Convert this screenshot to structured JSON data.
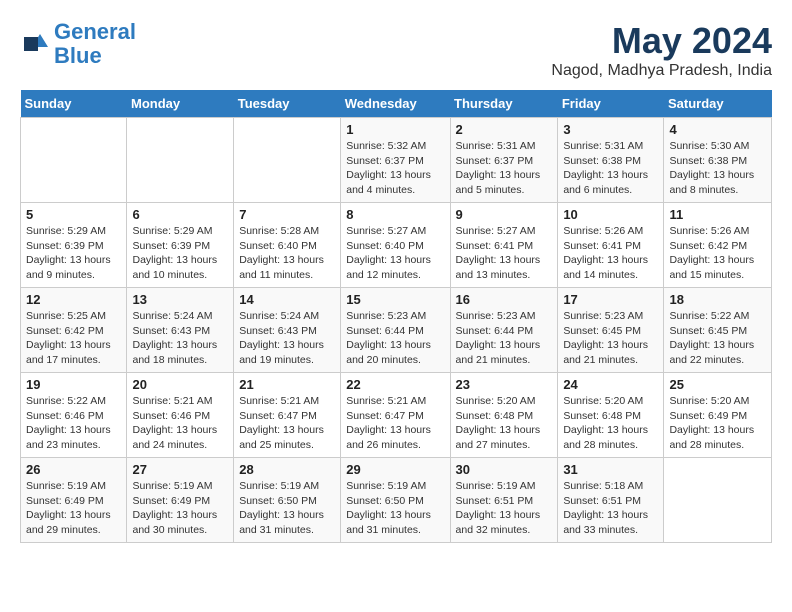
{
  "logo": {
    "line1": "General",
    "line2": "Blue"
  },
  "title": {
    "month_year": "May 2024",
    "location": "Nagod, Madhya Pradesh, India"
  },
  "headers": [
    "Sunday",
    "Monday",
    "Tuesday",
    "Wednesday",
    "Thursday",
    "Friday",
    "Saturday"
  ],
  "weeks": [
    [
      {
        "day": "",
        "info": ""
      },
      {
        "day": "",
        "info": ""
      },
      {
        "day": "",
        "info": ""
      },
      {
        "day": "1",
        "info": "Sunrise: 5:32 AM\nSunset: 6:37 PM\nDaylight: 13 hours\nand 4 minutes."
      },
      {
        "day": "2",
        "info": "Sunrise: 5:31 AM\nSunset: 6:37 PM\nDaylight: 13 hours\nand 5 minutes."
      },
      {
        "day": "3",
        "info": "Sunrise: 5:31 AM\nSunset: 6:38 PM\nDaylight: 13 hours\nand 6 minutes."
      },
      {
        "day": "4",
        "info": "Sunrise: 5:30 AM\nSunset: 6:38 PM\nDaylight: 13 hours\nand 8 minutes."
      }
    ],
    [
      {
        "day": "5",
        "info": "Sunrise: 5:29 AM\nSunset: 6:39 PM\nDaylight: 13 hours\nand 9 minutes."
      },
      {
        "day": "6",
        "info": "Sunrise: 5:29 AM\nSunset: 6:39 PM\nDaylight: 13 hours\nand 10 minutes."
      },
      {
        "day": "7",
        "info": "Sunrise: 5:28 AM\nSunset: 6:40 PM\nDaylight: 13 hours\nand 11 minutes."
      },
      {
        "day": "8",
        "info": "Sunrise: 5:27 AM\nSunset: 6:40 PM\nDaylight: 13 hours\nand 12 minutes."
      },
      {
        "day": "9",
        "info": "Sunrise: 5:27 AM\nSunset: 6:41 PM\nDaylight: 13 hours\nand 13 minutes."
      },
      {
        "day": "10",
        "info": "Sunrise: 5:26 AM\nSunset: 6:41 PM\nDaylight: 13 hours\nand 14 minutes."
      },
      {
        "day": "11",
        "info": "Sunrise: 5:26 AM\nSunset: 6:42 PM\nDaylight: 13 hours\nand 15 minutes."
      }
    ],
    [
      {
        "day": "12",
        "info": "Sunrise: 5:25 AM\nSunset: 6:42 PM\nDaylight: 13 hours\nand 17 minutes."
      },
      {
        "day": "13",
        "info": "Sunrise: 5:24 AM\nSunset: 6:43 PM\nDaylight: 13 hours\nand 18 minutes."
      },
      {
        "day": "14",
        "info": "Sunrise: 5:24 AM\nSunset: 6:43 PM\nDaylight: 13 hours\nand 19 minutes."
      },
      {
        "day": "15",
        "info": "Sunrise: 5:23 AM\nSunset: 6:44 PM\nDaylight: 13 hours\nand 20 minutes."
      },
      {
        "day": "16",
        "info": "Sunrise: 5:23 AM\nSunset: 6:44 PM\nDaylight: 13 hours\nand 21 minutes."
      },
      {
        "day": "17",
        "info": "Sunrise: 5:23 AM\nSunset: 6:45 PM\nDaylight: 13 hours\nand 21 minutes."
      },
      {
        "day": "18",
        "info": "Sunrise: 5:22 AM\nSunset: 6:45 PM\nDaylight: 13 hours\nand 22 minutes."
      }
    ],
    [
      {
        "day": "19",
        "info": "Sunrise: 5:22 AM\nSunset: 6:46 PM\nDaylight: 13 hours\nand 23 minutes."
      },
      {
        "day": "20",
        "info": "Sunrise: 5:21 AM\nSunset: 6:46 PM\nDaylight: 13 hours\nand 24 minutes."
      },
      {
        "day": "21",
        "info": "Sunrise: 5:21 AM\nSunset: 6:47 PM\nDaylight: 13 hours\nand 25 minutes."
      },
      {
        "day": "22",
        "info": "Sunrise: 5:21 AM\nSunset: 6:47 PM\nDaylight: 13 hours\nand 26 minutes."
      },
      {
        "day": "23",
        "info": "Sunrise: 5:20 AM\nSunset: 6:48 PM\nDaylight: 13 hours\nand 27 minutes."
      },
      {
        "day": "24",
        "info": "Sunrise: 5:20 AM\nSunset: 6:48 PM\nDaylight: 13 hours\nand 28 minutes."
      },
      {
        "day": "25",
        "info": "Sunrise: 5:20 AM\nSunset: 6:49 PM\nDaylight: 13 hours\nand 28 minutes."
      }
    ],
    [
      {
        "day": "26",
        "info": "Sunrise: 5:19 AM\nSunset: 6:49 PM\nDaylight: 13 hours\nand 29 minutes."
      },
      {
        "day": "27",
        "info": "Sunrise: 5:19 AM\nSunset: 6:49 PM\nDaylight: 13 hours\nand 30 minutes."
      },
      {
        "day": "28",
        "info": "Sunrise: 5:19 AM\nSunset: 6:50 PM\nDaylight: 13 hours\nand 31 minutes."
      },
      {
        "day": "29",
        "info": "Sunrise: 5:19 AM\nSunset: 6:50 PM\nDaylight: 13 hours\nand 31 minutes."
      },
      {
        "day": "30",
        "info": "Sunrise: 5:19 AM\nSunset: 6:51 PM\nDaylight: 13 hours\nand 32 minutes."
      },
      {
        "day": "31",
        "info": "Sunrise: 5:18 AM\nSunset: 6:51 PM\nDaylight: 13 hours\nand 33 minutes."
      },
      {
        "day": "",
        "info": ""
      }
    ]
  ]
}
